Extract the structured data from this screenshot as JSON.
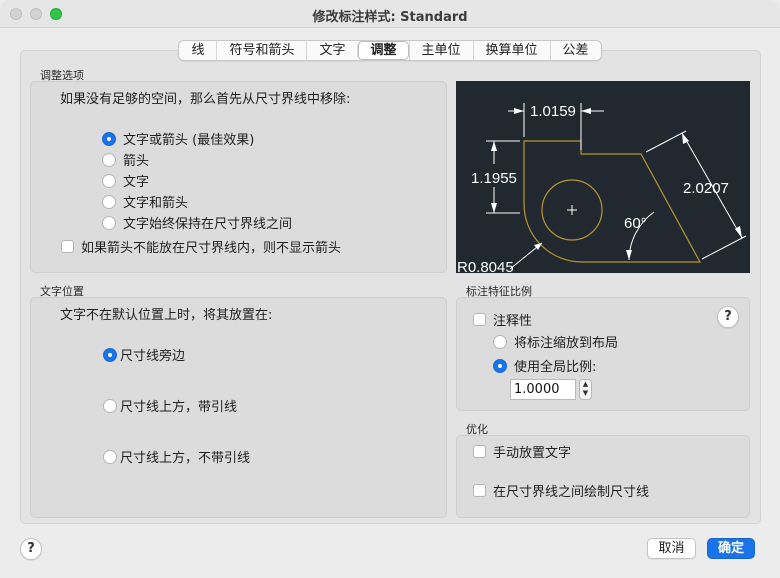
{
  "window": {
    "title": "修改标注样式: Standard"
  },
  "tabs": [
    {
      "label": "线",
      "active": false
    },
    {
      "label": "符号和箭头",
      "active": false
    },
    {
      "label": "文字",
      "active": false
    },
    {
      "label": "调整",
      "active": true
    },
    {
      "label": "主单位",
      "active": false
    },
    {
      "label": "换算单位",
      "active": false
    },
    {
      "label": "公差",
      "active": false
    }
  ],
  "fit_options": {
    "group_label": "调整选项",
    "prompt": "如果没有足够的空间，那么首先从尺寸界线中移除:",
    "radios": [
      {
        "label": "文字或箭头 (最佳效果)",
        "selected": true
      },
      {
        "label": "箭头",
        "selected": false
      },
      {
        "label": "文字",
        "selected": false
      },
      {
        "label": "文字和箭头",
        "selected": false
      },
      {
        "label": "文字始终保持在尺寸界线之间",
        "selected": false
      }
    ],
    "suppress_arrows": {
      "label": "如果箭头不能放在尺寸界线内，则不显示箭头",
      "checked": false
    }
  },
  "preview": {
    "labels": {
      "top_dim": "1.0159",
      "left_dim": "1.1955",
      "right_dim": "2.0207",
      "angle": "60°",
      "radius": "R0.8045"
    },
    "colors": {
      "background": "#212830",
      "dimension": "#ffffff",
      "geometry": "#b8962e"
    }
  },
  "text_placement": {
    "group_label": "文字位置",
    "prompt": "文字不在默认位置上时，将其放置在:",
    "radios": [
      {
        "label": "尺寸线旁边",
        "selected": true
      },
      {
        "label": "尺寸线上方，带引线",
        "selected": false
      },
      {
        "label": "尺寸线上方，不带引线",
        "selected": false
      }
    ]
  },
  "scale": {
    "group_label": "标注特征比例",
    "annotative": {
      "label": "注释性",
      "checked": false
    },
    "radios": [
      {
        "label": "将标注缩放到布局",
        "selected": false
      },
      {
        "label": "使用全局比例:",
        "selected": true
      }
    ],
    "value": "1.0000",
    "stepper_up": "▲",
    "stepper_down": "▼"
  },
  "finetune": {
    "group_label": "优化",
    "checks": [
      {
        "label": "手动放置文字",
        "checked": false
      },
      {
        "label": "在尺寸界线之间绘制尺寸线",
        "checked": false
      }
    ]
  },
  "help_glyph": "?",
  "buttons": {
    "cancel": "取消",
    "ok": "确定"
  },
  "accent_color": "#1a73e8"
}
